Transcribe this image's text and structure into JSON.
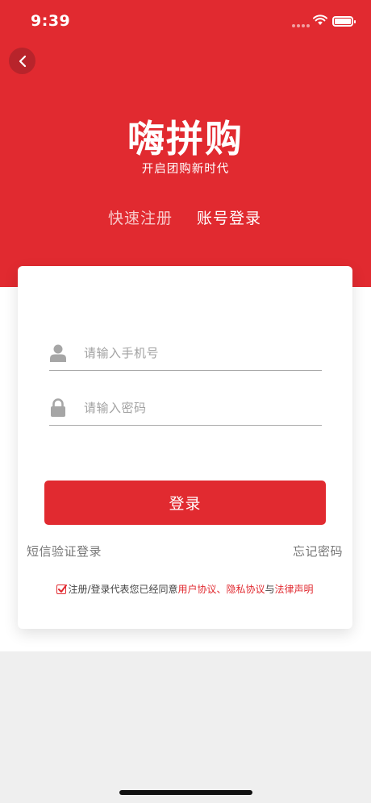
{
  "status_bar": {
    "time": "9:39",
    "battery_level": 1.0
  },
  "header": {
    "back_icon": "chevron-left-icon",
    "brand": "嗨拼购",
    "slogan": "开启团购新时代"
  },
  "tabs": {
    "register": "快速注册",
    "login": "账号登录",
    "active": "login"
  },
  "form": {
    "phone": {
      "placeholder": "请输入手机号",
      "value": "",
      "icon": "user-icon"
    },
    "password": {
      "placeholder": "请输入密码",
      "value": "",
      "icon": "lock-icon"
    },
    "login_label": "登录",
    "sms_login": "短信验证登录",
    "forgot_password": "忘记密码"
  },
  "agreement": {
    "checked": true,
    "prefix": "注册/登录代表您已经同意",
    "user_agreement": "用户协议",
    "separator": "、",
    "privacy_policy": "隐私协议",
    "conjunction": "与",
    "legal_notice": "法律声明"
  },
  "colors": {
    "brand_red": "#e12a30",
    "back_button": "#b8242b",
    "placeholder": "#a2a2a2",
    "link_gray": "#777777"
  }
}
